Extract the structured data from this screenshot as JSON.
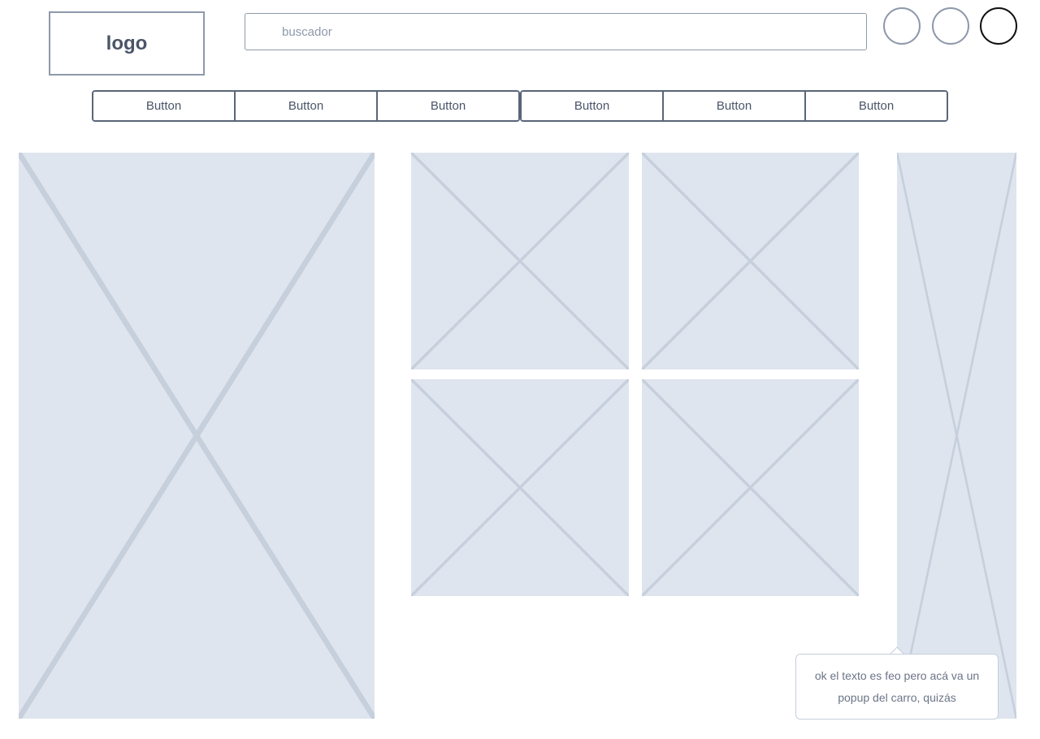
{
  "header": {
    "logo_text": "logo",
    "search": {
      "value": "",
      "placeholder": "buscador"
    },
    "icons": [
      "circle-icon",
      "circle-icon",
      "circle-icon"
    ]
  },
  "nav": {
    "buttons": [
      {
        "label": "Button"
      },
      {
        "label": "Button"
      },
      {
        "label": "Button"
      },
      {
        "label": "Button"
      },
      {
        "label": "Button"
      },
      {
        "label": "Button"
      }
    ]
  },
  "popup": {
    "text": "ok el texto es feo pero acá va un popup del carro, quizás"
  },
  "colors": {
    "placeholder_fill": "#dfe5ee",
    "placeholder_cross": "#c6cfdc",
    "border": "#8e99ab",
    "button_border": "#5a6578",
    "active_circle": "#111111"
  }
}
